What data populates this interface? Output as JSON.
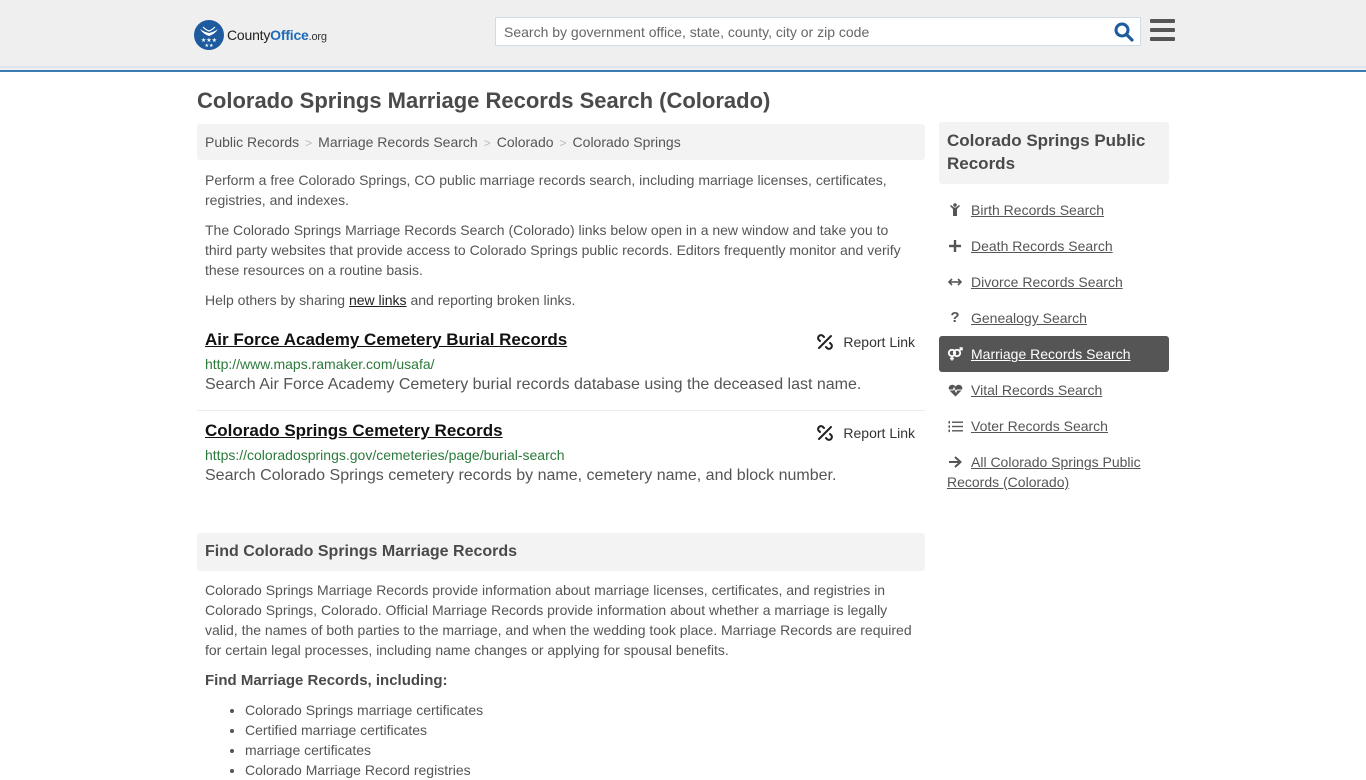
{
  "header": {
    "logo": {
      "county": "County",
      "office": "Office",
      "tld": ".org"
    },
    "search_placeholder": "Search by government office, state, county, city or zip code",
    "search_value": ""
  },
  "page_title": "Colorado Springs Marriage Records Search (Colorado)",
  "breadcrumb": [
    {
      "label": "Public Records"
    },
    {
      "label": "Marriage Records Search"
    },
    {
      "label": "Colorado"
    },
    {
      "label": "Colorado Springs"
    }
  ],
  "intro": {
    "p1": "Perform a free Colorado Springs, CO public marriage records search, including marriage licenses, certificates, registries, and indexes.",
    "p2": "The Colorado Springs Marriage Records Search (Colorado) links below open in a new window and take you to third party websites that provide access to Colorado Springs public records. Editors frequently monitor and verify these resources on a routine basis.",
    "p3_before": "Help others by sharing ",
    "p3_link": "new links",
    "p3_after": " and reporting broken links."
  },
  "links": [
    {
      "title": "Air Force Academy Cemetery Burial Records",
      "url": "http://www.maps.ramaker.com/usafa/",
      "description": "Search Air Force Academy Cemetery burial records database using the deceased last name.",
      "report_label": "Report Link"
    },
    {
      "title": "Colorado Springs Cemetery Records",
      "url": "https://coloradosprings.gov/cemeteries/page/burial-search",
      "description": "Search Colorado Springs cemetery records by name, cemetery name, and block number.",
      "report_label": "Report Link"
    }
  ],
  "find_section": {
    "heading": "Find Colorado Springs Marriage Records",
    "body": "Colorado Springs Marriage Records provide information about marriage licenses, certificates, and registries in Colorado Springs, Colorado. Official Marriage Records provide information about whether a marriage is legally valid, the names of both parties to the marriage, and when the wedding took place. Marriage Records are required for certain legal processes, including name changes or applying for spousal benefits.",
    "subheading": "Find Marriage Records, including:",
    "bullets": [
      "Colorado Springs marriage certificates",
      "Certified marriage certificates",
      "marriage certificates",
      "Colorado Marriage Record registries"
    ]
  },
  "sidebar": {
    "heading": "Colorado Springs Public Records",
    "items": [
      {
        "label": "Birth Records Search",
        "icon": "child-icon"
      },
      {
        "label": "Death Records Search",
        "icon": "plus-icon"
      },
      {
        "label": "Divorce Records Search",
        "icon": "arrows-horizontal-icon"
      },
      {
        "label": "Genealogy Search",
        "icon": "question-icon"
      },
      {
        "label": "Marriage Records Search",
        "icon": "venus-mars-icon",
        "active": true
      },
      {
        "label": "Vital Records Search",
        "icon": "heartbeat-icon"
      },
      {
        "label": "Voter Records Search",
        "icon": "list-ol-icon"
      },
      {
        "label": "All Colorado Springs Public Records (Colorado)",
        "icon": "arrow-right-icon"
      }
    ]
  },
  "colors": {
    "brand_blue": "#1d6ab8",
    "header_border": "#3a7bb0",
    "url_green": "#2b7a3b",
    "active_bg": "#555555"
  }
}
